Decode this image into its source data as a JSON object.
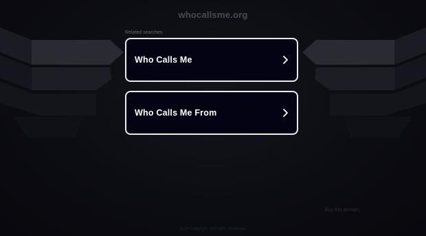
{
  "header": {
    "domain": "whocallsme.org"
  },
  "related": {
    "label": "Related searches",
    "items": [
      {
        "label": "Who Calls Me",
        "icon": "chevron-right-icon"
      },
      {
        "label": "Who Calls Me From",
        "icon": "chevron-right-icon"
      }
    ]
  },
  "footer": {
    "buy_label": "Buy this domain.",
    "copyright": "2024 Copyright. All Rights Reserved."
  },
  "colors": {
    "background": "#0b0b12",
    "card_background": "#030314",
    "card_border": "#ececf0",
    "text": "#ffffff"
  }
}
